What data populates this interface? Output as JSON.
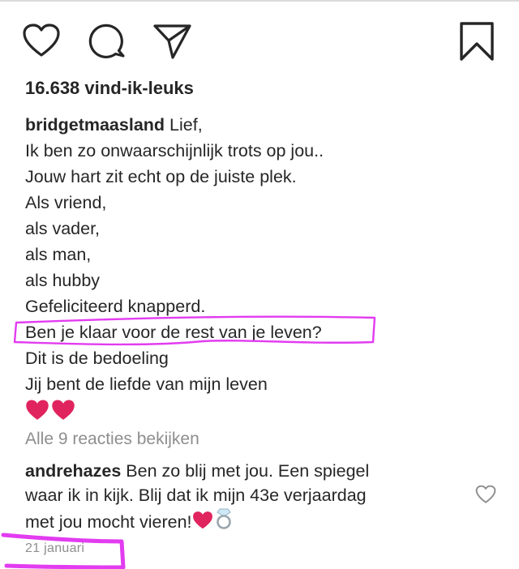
{
  "post": {
    "likes": "16.638 vind-ik-leuks",
    "caption": {
      "username": "bridgetmaasland",
      "first_line": "Lief,",
      "lines": [
        "Ik ben zo onwaarschijnlijk trots op jou..",
        "Jouw hart zit echt op de juiste plek.",
        "Als vriend,",
        "als vader,",
        "als man,",
        "als hubby",
        "Gefeliciteerd knapperd.",
        "Ben je klaar voor de rest van je leven?",
        "Dit is de bedoeling",
        "Jij bent de liefde van mijn leven"
      ],
      "emoji": [
        "❤️",
        "❤️"
      ]
    },
    "view_all_comments": "Alle 9 reacties bekijken",
    "comment": {
      "username": "andrehazes",
      "line1": "Ben zo blij met jou. Een spiegel",
      "line2": "waar ik in kijk. Blij dat ik mijn 43e verjaardag",
      "line3": "met jou mocht vieren!"
    },
    "date": "21 januari"
  },
  "icons": {
    "like": "heart-outline-icon",
    "comment": "speech-bubble-icon",
    "share": "paper-plane-icon",
    "save": "bookmark-icon",
    "comment_like": "heart-outline-icon",
    "ring": "ring-icon"
  },
  "colors": {
    "text": "#262626",
    "muted": "#8e8e8e",
    "heart_red": "#e0245e",
    "highlight": "#e23cf0"
  }
}
